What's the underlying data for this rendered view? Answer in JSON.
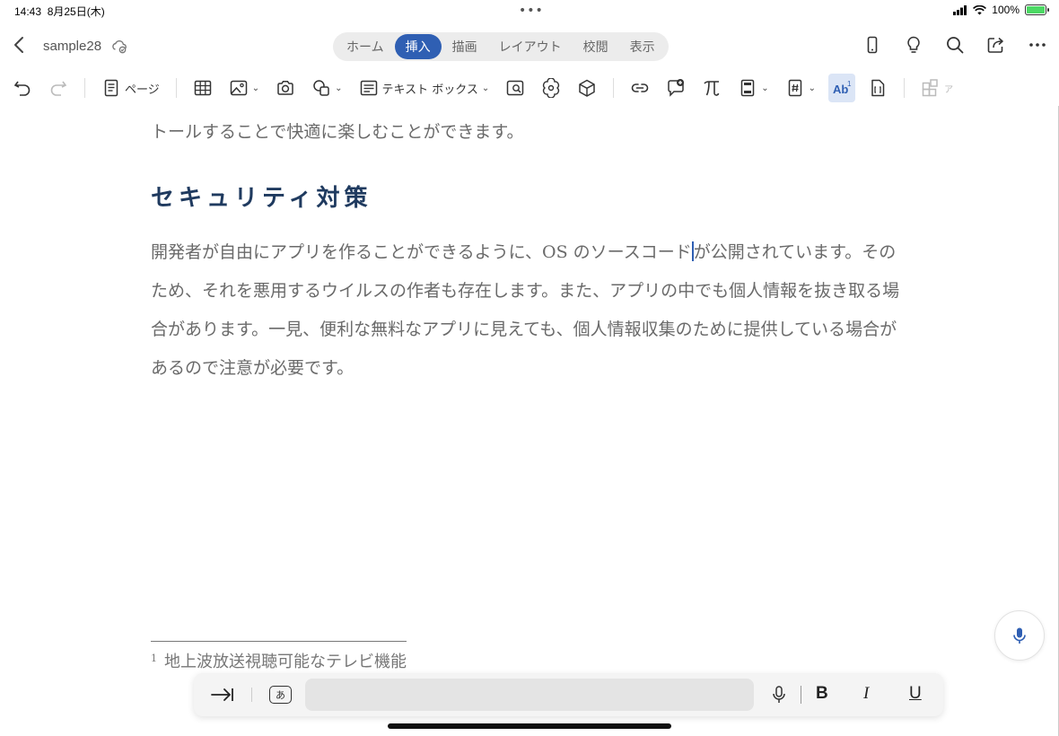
{
  "status": {
    "time": "14:43",
    "date": "8月25日(木)",
    "battery": "100%",
    "battery_level": 1.0
  },
  "titlebar": {
    "doc_name": "sample28",
    "tabs": [
      {
        "label": "ホーム",
        "active": false
      },
      {
        "label": "挿入",
        "active": true
      },
      {
        "label": "描画",
        "active": false
      },
      {
        "label": "レイアウト",
        "active": false
      },
      {
        "label": "校閲",
        "active": false
      },
      {
        "label": "表示",
        "active": false
      }
    ]
  },
  "ribbon": {
    "page_label": "ページ",
    "textbox_label": "テキスト ボックス",
    "overflow_label": "ア"
  },
  "document": {
    "top_line": "トールすることで快適に楽しむことができます。",
    "heading": "セキュリティ対策",
    "body_before_cursor": "開発者が自由にアプリを作ることができるように、OS のソースコード",
    "body_after_cursor": "が公開されています。そのため、それを悪用するウイルスの作者も存在します。また、アプリの中でも個人情報を抜き取る場合があります。一見、便利な無料なアプリに見えても、個人情報収集のために提供している場合があるので注意が必要です。",
    "footnote_number": "1",
    "footnote_text": "地上波放送視聴可能なテレビ機能"
  },
  "keyboard_bar": {
    "ime_label": "あ",
    "bold": "B",
    "italic": "I",
    "underline": "U"
  },
  "colors": {
    "accent": "#2f5fb3",
    "heading": "#1f3a5f",
    "body_text": "#6a6a6a"
  }
}
